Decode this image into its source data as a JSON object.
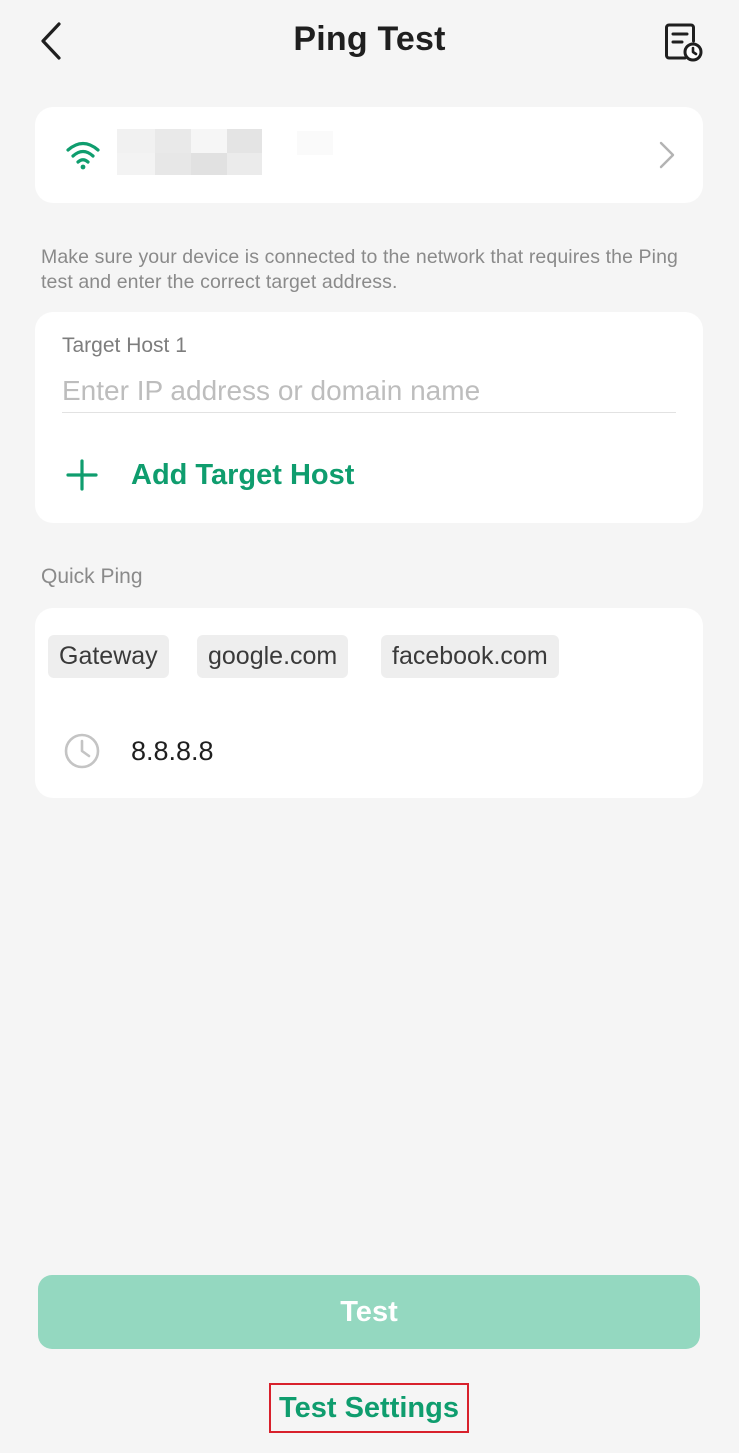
{
  "header": {
    "title": "Ping Test",
    "back_icon": "chevron-left-icon",
    "history_icon": "test-history-icon"
  },
  "network": {
    "icon": "wifi-icon",
    "name_redacted": true,
    "chevron_icon": "chevron-right-icon"
  },
  "hint": "Make sure your device is connected to the network that requires the Ping test and enter the correct target address.",
  "target": {
    "label": "Target Host 1",
    "placeholder": "Enter IP address or domain name",
    "value": "",
    "add_label": "Add Target Host"
  },
  "quick_ping": {
    "label": "Quick Ping",
    "chips": [
      "Gateway",
      "google.com",
      "facebook.com"
    ],
    "history": [
      "8.8.8.8"
    ]
  },
  "actions": {
    "test_label": "Test",
    "settings_label": "Test Settings"
  },
  "colors": {
    "accent": "#0f9d6e",
    "button_disabled": "#94d8c0",
    "background": "#f5f5f5",
    "highlight_border": "#d8212c"
  }
}
